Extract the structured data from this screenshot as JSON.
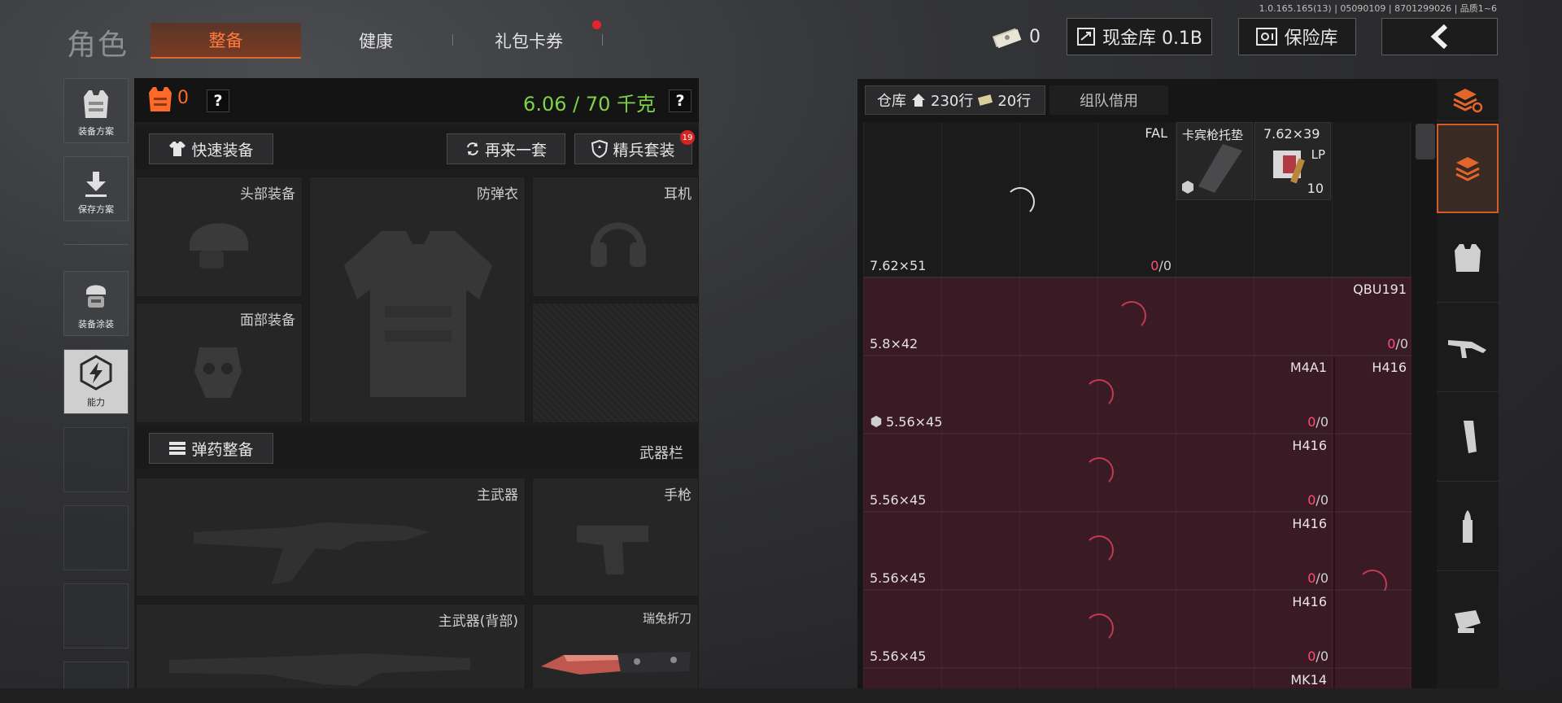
{
  "version": "1.0.165.165(13) | 05090109 | 8701299026 | 品质1~6",
  "title": "角色",
  "tabs": {
    "gear": "整备",
    "health": "健康",
    "gift": "礼包卡券"
  },
  "header": {
    "money": "0",
    "cash_vault": "现金库 0.1B",
    "safe": "保险库"
  },
  "sidebar": {
    "plan": "装备方案",
    "save": "保存方案",
    "paint": "装备涂装",
    "ability": "能力"
  },
  "equip": {
    "armor_count": "0",
    "help": "?",
    "weight": "6.06 / 70 千克",
    "quick_equip": "快速装备",
    "again": "再来一套",
    "elite": "精兵套装",
    "elite_badge": "19",
    "slots": {
      "head": "头部装备",
      "vest": "防弹衣",
      "headset": "耳机",
      "face": "面部装备"
    },
    "ammo_equip": "弹药整备",
    "weapon_bar": "武器栏",
    "weapons": {
      "primary": "主武器",
      "pistol": "手枪",
      "primary_back": "主武器(背部)",
      "knife": "瑞兔折刀"
    }
  },
  "storage": {
    "tab_label": "仓库",
    "rows_total": "230行",
    "rows_extra": "20行",
    "team_borrow": "组队借用",
    "rows": [
      {
        "caliber": "7.62×51",
        "weapon": "FAL",
        "count_a": "0",
        "count_b": "/0",
        "items": [
          {
            "name": "卡宾枪托垫"
          },
          {
            "name": "7.62×39",
            "tag": "LP",
            "qty": "10"
          }
        ]
      },
      {
        "caliber": "5.8×42",
        "weapon": "QBU191",
        "count_a": "0",
        "count_b": "/0"
      },
      {
        "caliber": "5.56×45",
        "weapon": "M4A1",
        "weapon2": "H416",
        "count_a": "0",
        "count_b": "/0"
      },
      {
        "caliber": "5.56×45",
        "weapon": "H416",
        "count_a": "0",
        "count_b": "/0"
      },
      {
        "caliber": "5.56×45",
        "weapon": "H416",
        "count_a": "0",
        "count_b": "/0"
      },
      {
        "caliber": "5.56×45",
        "weapon": "H416",
        "count_a": "0",
        "count_b": "/0"
      },
      {
        "caliber": "",
        "weapon": "MK14",
        "count_a": "",
        "count_b": ""
      }
    ]
  },
  "colors": {
    "accent": "#ff6a2a",
    "weight": "#7fd246",
    "count": "#ff4d7a",
    "row_bg": "#3a1a24"
  }
}
